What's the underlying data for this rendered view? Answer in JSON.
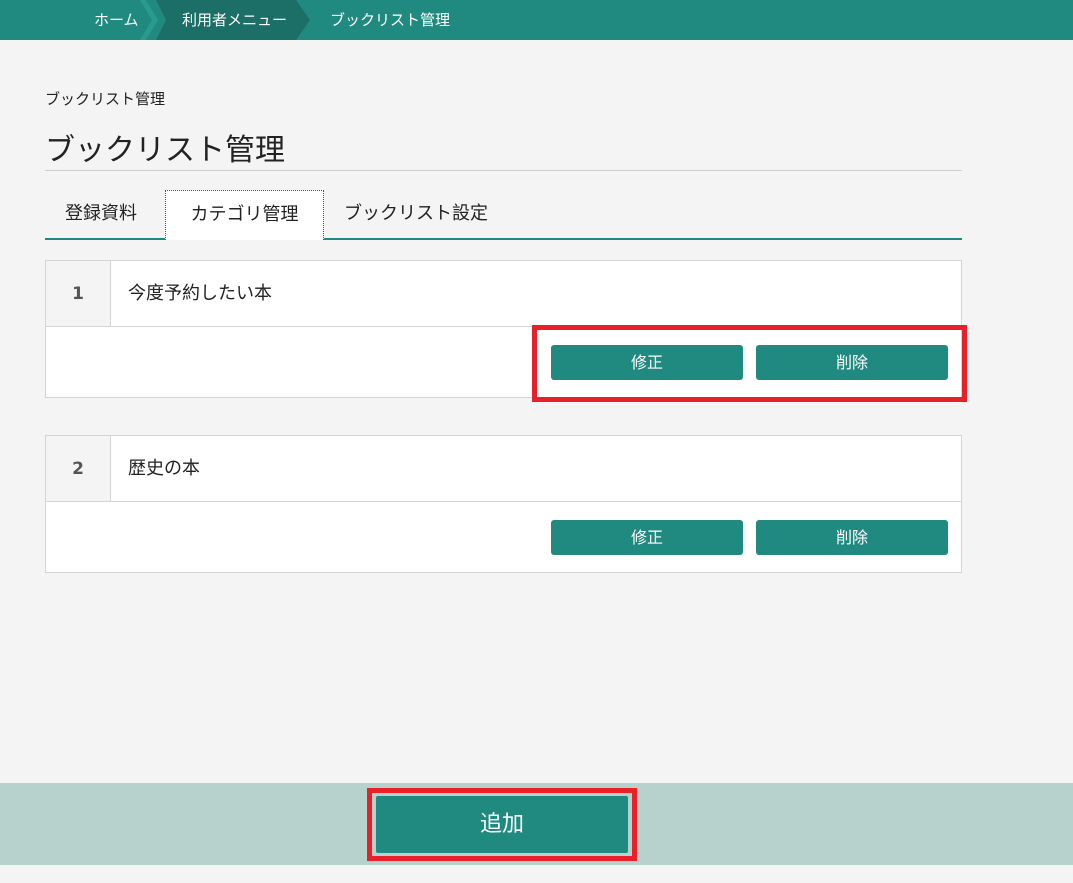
{
  "breadcrumb": {
    "home": "ホーム",
    "user_menu": "利用者メニュー",
    "current": "ブックリスト管理"
  },
  "page": {
    "small_title": "ブックリスト管理",
    "title": "ブックリスト管理"
  },
  "tabs": [
    {
      "label": "登録資料",
      "active": false
    },
    {
      "label": "カテゴリ管理",
      "active": true
    },
    {
      "label": "ブックリスト設定",
      "active": false
    }
  ],
  "categories": [
    {
      "number": "1",
      "name": "今度予約したい本",
      "edit_label": "修正",
      "delete_label": "削除"
    },
    {
      "number": "2",
      "name": "歴史の本",
      "edit_label": "修正",
      "delete_label": "削除"
    }
  ],
  "footer": {
    "add_label": "追加"
  },
  "colors": {
    "accent": "#208a80",
    "accent_dark": "#1b6f67",
    "footer_bg": "#b7d1cd",
    "highlight": "#e8202a"
  }
}
